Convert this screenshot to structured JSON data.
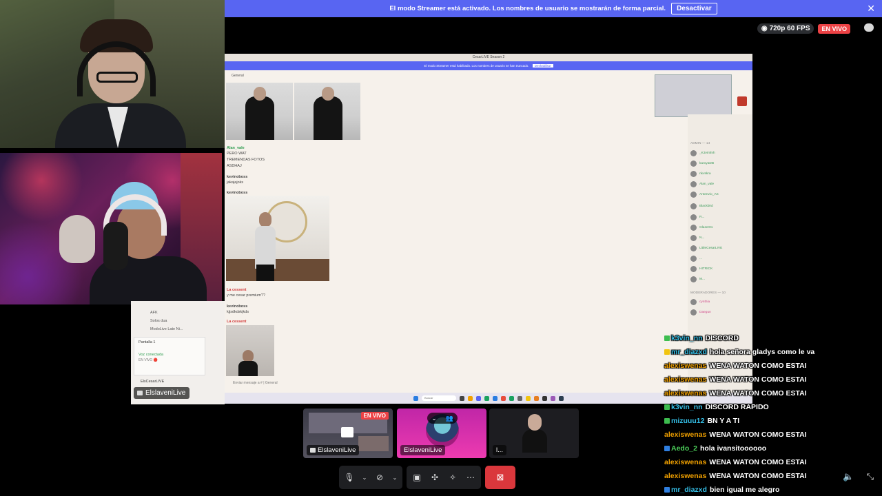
{
  "banner": {
    "text": "El modo Streamer está activado. Los nombres de usuario se mostrarán de forma parcial.",
    "button": "Desactivar",
    "close_icon": "close-icon"
  },
  "stream": {
    "quality": "720p 60 FPS",
    "live": "EN VIVO"
  },
  "shared_screen": {
    "window_title": "CesarLIVE Season 2",
    "inner_banner": "El modo Streamer está habilitado. Los nombres de usuario se han truncado.",
    "inner_banner_btn": "Deshabilitar",
    "channel": "General",
    "messages": [
      {
        "user": "Alan_vale",
        "time": "17:05",
        "lines": [
          "PERO WAT",
          "TREMENDAS FOTOS",
          "ASDHAJ"
        ]
      },
      {
        "user": "kevinoboss",
        "time": "17:06",
        "lines": [
          "jakajajoks"
        ]
      },
      {
        "user": "kevinoboss",
        "time": "20:38",
        "lines": []
      },
      {
        "user": "La cessent",
        "time": "20:39",
        "lines": [
          "y me cesar premium??"
        ]
      },
      {
        "user": "kevinoboss",
        "time": "20:39",
        "lines": [
          "kjjsdkdskjkds"
        ]
      },
      {
        "user": "La cessent",
        "time": "20:40",
        "lines": []
      }
    ],
    "input_placeholder": "Enviar mensaje a # | General",
    "taskbar_search": "Buscar",
    "members_header_admin": "ADMIN — 14",
    "members_header_mods": "MODERADORES — 10",
    "members": [
      "_K3vinfmh",
      "karoyaDB",
      "nkvskra",
      "Alan_vale",
      "Antenvio_AS",
      "Blackbird",
      "R...",
      "Glazer01",
      "N...",
      "LittleCesarLIVE",
      "...",
      "HITRICK",
      "M...",
      "cynthia",
      "Daegun"
    ]
  },
  "discord_fragment": {
    "rows": [
      "AFK",
      "Solos dua",
      "ModoLive Late Ni..."
    ],
    "screen_label": "Pantalla 1",
    "voice_status": "Voz conectada",
    "voice_sub": "EN VIVO 🔴",
    "user": "ElsCesarLIVE",
    "chip_label": "ElslaveniLive"
  },
  "thumbnails": [
    {
      "label": "ElslaveniLive",
      "live": "EN VIVO"
    },
    {
      "label": "ElslaveniLive"
    },
    {
      "label": "l..."
    }
  ],
  "controls": {
    "mic_icon": "microphone-icon",
    "camera_icon": "camera-off-icon",
    "screen_icon": "screen-share-icon",
    "activity_icon": "activities-icon",
    "soundboard_icon": "soundboard-icon",
    "more_icon": "more-icon",
    "hangup_icon": "hangup-icon"
  },
  "chat": [
    {
      "user": "k3vin_nn",
      "color": "#35c0e8",
      "badge": "#3dbd4f",
      "msg": "DISCORD"
    },
    {
      "user": "mr_diazxd",
      "color": "#35c0e8",
      "badge": "#f1c40f",
      "msg": "hola señora gladys como le va"
    },
    {
      "user": "alexiswenas",
      "color": "#f0a000",
      "badge": "",
      "msg": "WENA WATON COMO ESTAI"
    },
    {
      "user": "alexiswenas",
      "color": "#f0a000",
      "badge": "",
      "msg": "WENA WATON COMO ESTAI"
    },
    {
      "user": "alexiswenas",
      "color": "#f0a000",
      "badge": "",
      "msg": "WENA WATON COMO ESTAI"
    },
    {
      "user": "k3vin_nn",
      "color": "#35c0e8",
      "badge": "#3dbd4f",
      "msg": "DISCORD RAPIDO"
    },
    {
      "user": "mizuuu12",
      "color": "#35c0e8",
      "badge": "#3dbd4f",
      "msg": "BN Y A TI"
    },
    {
      "user": "alexiswenas",
      "color": "#f0a000",
      "badge": "",
      "msg": "WENA WATON COMO ESTAI"
    },
    {
      "user": "Aedo_2",
      "color": "#4cd05a",
      "badge": "#2f7fe0",
      "msg": "hola ivansitoooooo"
    },
    {
      "user": "alexiswenas",
      "color": "#f0a000",
      "badge": "",
      "msg": "WENA WATON COMO ESTAI"
    },
    {
      "user": "alexiswenas",
      "color": "#f0a000",
      "badge": "",
      "msg": "WENA WATON COMO ESTAI"
    },
    {
      "user": "mr_diazxd",
      "color": "#35c0e8",
      "badge": "#2f7fe0",
      "msg": "bien igual me alegro"
    }
  ]
}
